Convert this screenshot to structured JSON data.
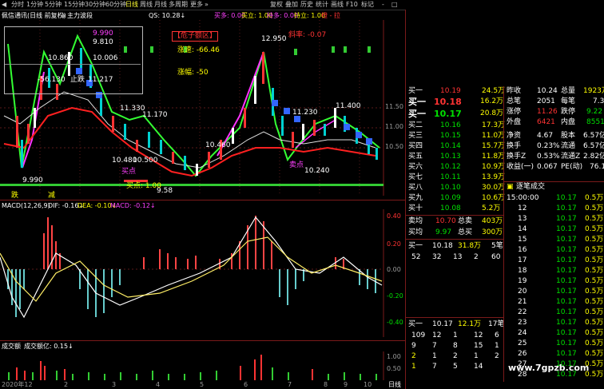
{
  "toolbar": {
    "left_items": [
      "分时",
      "1分钟",
      "5分钟",
      "15分钟",
      "30分钟",
      "60分钟",
      "日线",
      "周线",
      "月线",
      "多周期",
      "更多"
    ],
    "selected": "日线",
    "right_items": [
      "复权",
      "叠加",
      "历史",
      "统计",
      "画线",
      "F10",
      "标记",
      "-",
      "□"
    ]
  },
  "main_header": {
    "stock": "佩信通讯(日线 前复权)",
    "indicator": "主力波段",
    "qs": "QS: 10.28↓",
    "buy_many": "买多: 0.00",
    "buy_stand": "买立: 1.00",
    "hold_many": "持多: 0.00",
    "hold_stand": "持立: 1.00",
    "flag": "橙 - 拉"
  },
  "overlay": {
    "dlg_values": [
      "9.990",
      "9.810",
      "10.860",
      "10.006",
      "-56.130",
      "11.217"
    ],
    "lbl_chuang": "创",
    "lbl_sheng": "高",
    "lbl_zhi": "止跌",
    "lbl_zd": "跌"
  },
  "annotations": {
    "red_box": "【危子额区】",
    "speed": "涨速: -66.46",
    "rise": "涨幅: -50",
    "bias": "斜率: -0.07",
    "p12950": "12.950",
    "p11330": "11.330",
    "p11170": "11.170",
    "p11230": "11.230",
    "p11400": "11.400",
    "p10480": "10.480",
    "p10500": "10.500",
    "p10460": "10.460",
    "p10240": "10.240",
    "p9990": "9.990",
    "p9580": "9.58",
    "buy_pt": "买点",
    "sell_pt": "卖点",
    "ping": "平仓",
    "bottom_tag": "买点: 1.00",
    "low_label": "跌",
    "mid_label": "减",
    "axis_tags": [
      "11.50",
      "11.00",
      "10.50"
    ]
  },
  "macd": {
    "header": "MACD(12,26,9)",
    "dif": "DIF: -0.16↓",
    "dea": "DEA: -0.10↓",
    "macd": "MACD: -0.12↓",
    "axis": [
      "0.40",
      "0.20",
      "0.00",
      "-0.20",
      "-0.40"
    ]
  },
  "volume": {
    "header": "成交额",
    "value": "成交额亿: 0.15↓",
    "axis": [
      "1.00",
      "0.50"
    ]
  },
  "bottom": {
    "date": "2020年12",
    "marks": [
      "2",
      "3",
      "4",
      "5",
      "6",
      "7",
      "8",
      "9",
      "10"
    ],
    "tab": "日线"
  },
  "quote": {
    "top_rows": [
      {
        "k": "买一",
        "p": "10.19",
        "v": "24.5万"
      },
      {
        "k": "买一",
        "p": "10.18",
        "v": "16.2万"
      },
      {
        "k": "买一",
        "p": "10.17",
        "v": "20.8万"
      },
      {
        "k": "买二",
        "p": "10.16",
        "v": "17.3万"
      },
      {
        "k": "买三",
        "p": "10.15",
        "v": "11.0万"
      },
      {
        "k": "买四",
        "p": "10.14",
        "v": "15.7万"
      },
      {
        "k": "买五",
        "p": "10.13",
        "v": "11.8万"
      },
      {
        "k": "买六",
        "p": "10.12",
        "v": "10.9万"
      },
      {
        "k": "买七",
        "p": "10.11",
        "v": "13.9万"
      },
      {
        "k": "买八",
        "p": "10.10",
        "v": "30.0万"
      },
      {
        "k": "买九",
        "p": "10.09",
        "v": "10.6万"
      },
      {
        "k": "买十",
        "p": "10.08",
        "v": "5.2万"
      }
    ],
    "avg_sell": {
      "k": "卖均",
      "p": "10.70",
      "t": "总卖",
      "v": "403万"
    },
    "avg_buy": {
      "k": "买均",
      "p": "9.97",
      "t": "总买",
      "v": "300万"
    },
    "mid_line": {
      "k": "买一",
      "p": "10.18",
      "v": "31.8万",
      "n": "5笔"
    },
    "mid_nums": [
      "52",
      "32",
      "13",
      "2",
      "60"
    ],
    "low_line": {
      "k": "买一",
      "p": "10.17",
      "v": "12.1万",
      "n": "17笔"
    },
    "low_grid": [
      [
        "109",
        "12",
        "1",
        "12",
        "6"
      ],
      [
        "9",
        "7",
        "8",
        "15",
        "1"
      ],
      [
        "2",
        "1",
        "2",
        "1",
        "2"
      ],
      [
        "1",
        "7",
        "5",
        "14",
        ""
      ]
    ],
    "stats": [
      {
        "a": "昨收",
        "av": "10.24",
        "b": "总量",
        "bv": "1923万"
      },
      {
        "a": "总笔",
        "av": "2051",
        "b": "每笔",
        "bv": "7.3"
      },
      {
        "a": "涨停",
        "av": "11.26",
        "b": "跌停",
        "bv": "9.22"
      },
      {
        "a": "外盘",
        "av": "6421",
        "b": "内盘",
        "bv": "8551"
      },
      {
        "a": "净资",
        "av": "4.67",
        "b": "股本",
        "bv": "6.57亿"
      },
      {
        "a": "换手",
        "av": "0.23%",
        "b": "流通",
        "bv": "6.57亿"
      },
      {
        "a": "换手Z",
        "av": "0.53%",
        "b": "流通Z",
        "bv": "2.82亿"
      },
      {
        "a": "收益(一)",
        "av": "0.067",
        "b": "PE(动)",
        "bv": "76.1"
      }
    ],
    "ticks_header": "逐笔成交",
    "ticks": [
      {
        "t": "15:00:00",
        "p": "10.17",
        "v": "0.5万"
      },
      {
        "t": "12",
        "p": "10.17",
        "v": "0.5万"
      },
      {
        "t": "13",
        "p": "10.17",
        "v": "0.5万"
      },
      {
        "t": "14",
        "p": "10.17",
        "v": "0.5万"
      },
      {
        "t": "15",
        "p": "10.17",
        "v": "0.5万"
      },
      {
        "t": "16",
        "p": "10.17",
        "v": "0.5万"
      },
      {
        "t": "17",
        "p": "10.17",
        "v": "0.5万"
      },
      {
        "t": "18",
        "p": "10.17",
        "v": "0.5万"
      },
      {
        "t": "19",
        "p": "10.17",
        "v": "0.5万"
      },
      {
        "t": "20",
        "p": "10.17",
        "v": "0.5万"
      },
      {
        "t": "21",
        "p": "10.17",
        "v": "0.5万"
      },
      {
        "t": "22",
        "p": "10.17",
        "v": "0.5万"
      },
      {
        "t": "23",
        "p": "10.17",
        "v": "0.5万"
      },
      {
        "t": "24",
        "p": "10.17",
        "v": "0.5万"
      },
      {
        "t": "25",
        "p": "10.17",
        "v": "0.5万"
      },
      {
        "t": "26",
        "p": "10.17",
        "v": "0.5万"
      },
      {
        "t": "27",
        "p": "10.17",
        "v": "0.5万"
      },
      {
        "t": "28",
        "p": "10.17",
        "v": "0.5万"
      },
      {
        "t": "29",
        "p": "10.17",
        "v": "0.5万"
      }
    ]
  },
  "watermark": "www.7gpzb.com",
  "colors": {
    "up": "#ff3333",
    "down": "#00d0d0",
    "bg": "#000000",
    "grid": "#7a1a1a",
    "accent": "#ffff00"
  }
}
